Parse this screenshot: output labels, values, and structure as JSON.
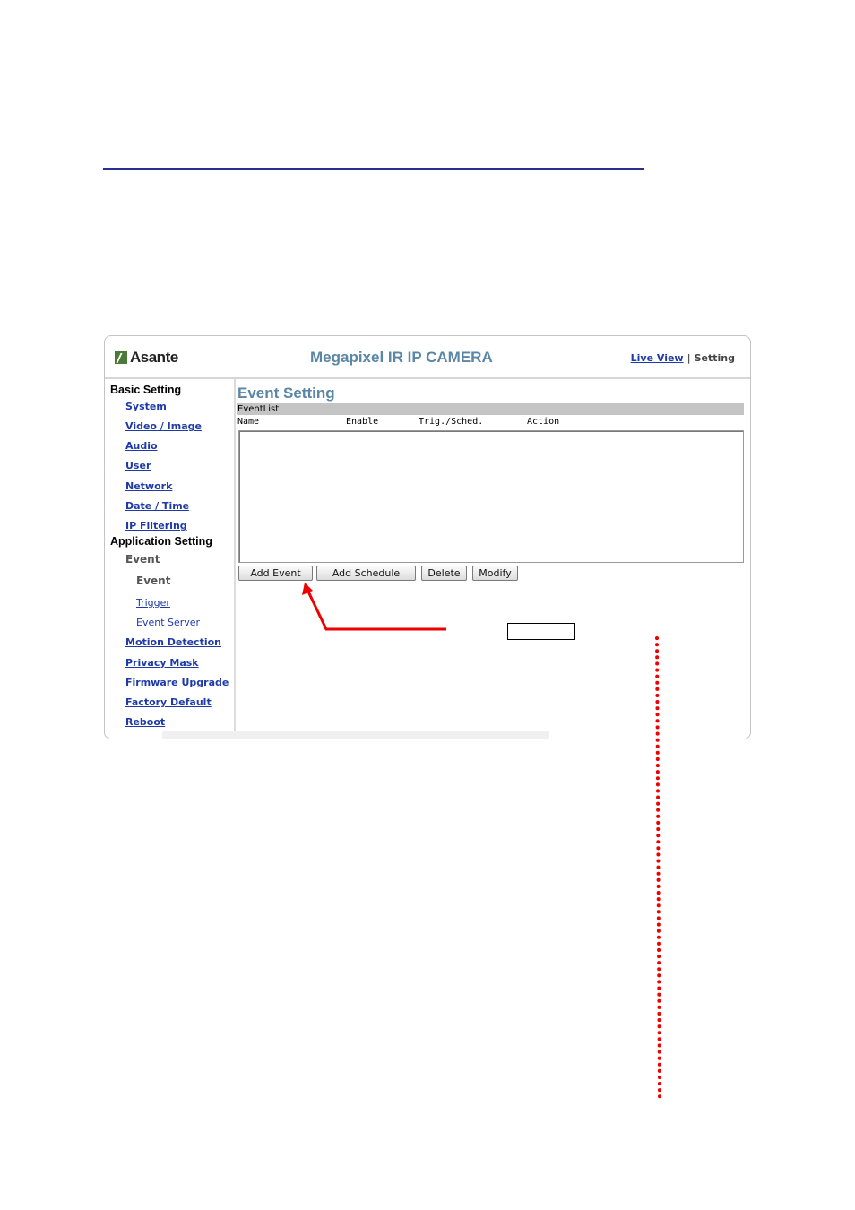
{
  "header": {
    "logo_text": "Asante",
    "title": "Megapixel IR IP CAMERA",
    "live_view": "Live View",
    "separator": "|",
    "setting": "Setting"
  },
  "sidebar": {
    "basic_heading": "Basic Setting",
    "basic_items": [
      "System",
      "Video / Image",
      "Audio",
      "User",
      "Network",
      "Date / Time",
      "IP Filtering"
    ],
    "app_heading": "Application Setting",
    "event_group": "Event",
    "event_sub_active": "Event",
    "event_sub_items": [
      "Trigger",
      "Event Server"
    ],
    "app_items": [
      "Motion Detection",
      "Privacy Mask",
      "Firmware Upgrade",
      "Factory Default",
      "Reboot"
    ]
  },
  "main": {
    "title": "Event Setting",
    "list_label": "EventList",
    "columns": [
      "Name",
      "Enable",
      "Trig./Sched.",
      "Action"
    ],
    "buttons": {
      "add_event": "Add Event",
      "add_schedule": "Add Schedule",
      "delete": "Delete",
      "modify": "Modify"
    }
  },
  "colors": {
    "title_blue": "#5a86a8",
    "link_blue": "#1e3aa8",
    "rule_navy": "#2b2e8c",
    "annotation_red": "#ee0000"
  },
  "icons": {
    "logo": "asante-logo-icon",
    "arrow": "red-arrow-icon"
  }
}
